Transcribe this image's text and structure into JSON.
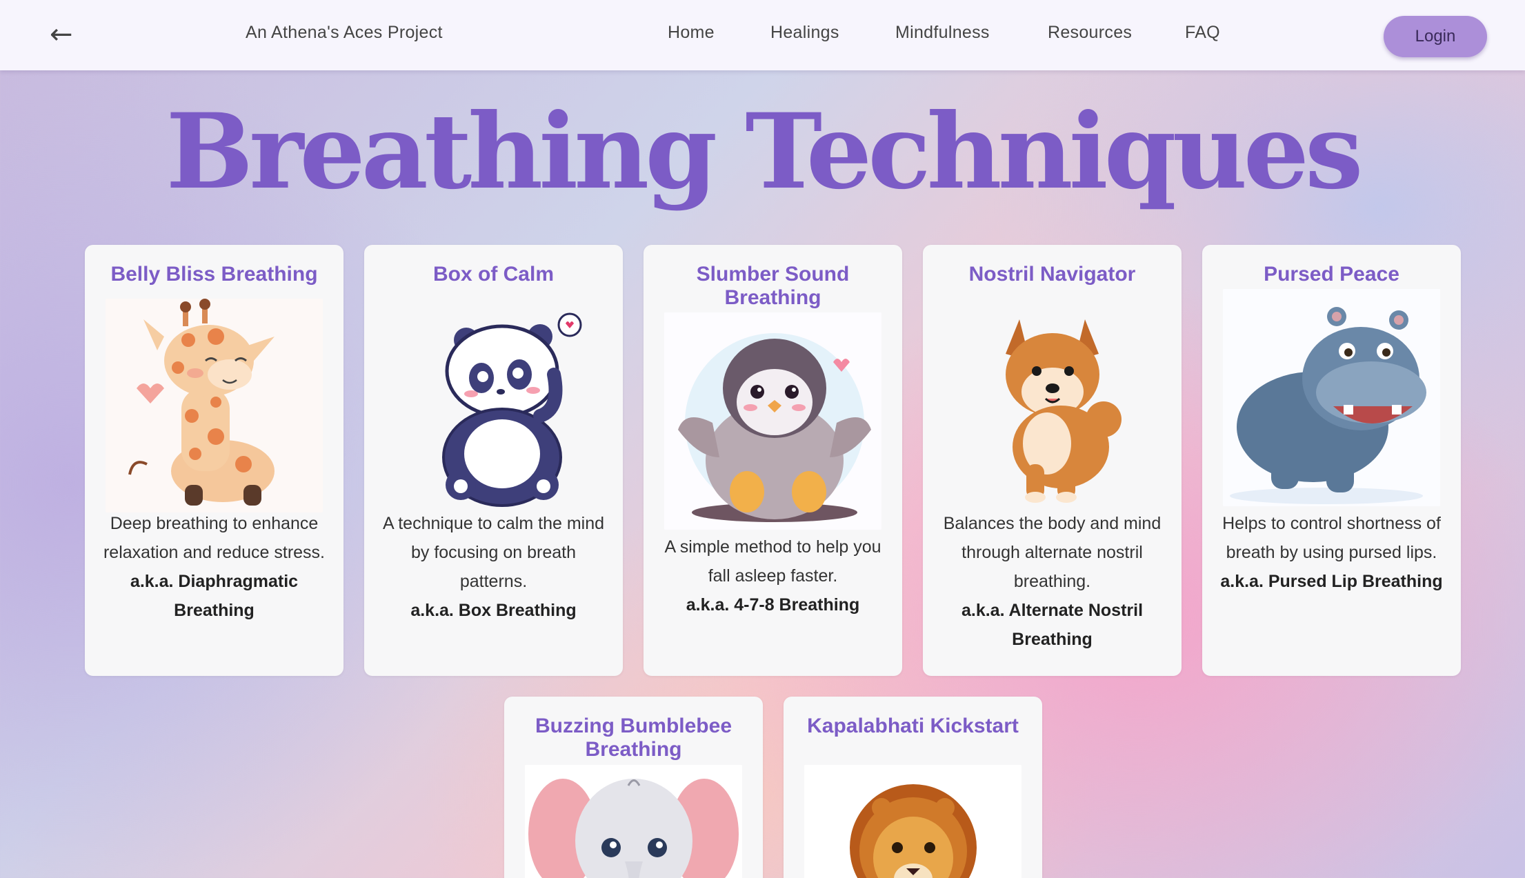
{
  "header": {
    "back_icon": "←",
    "brand": "An Athena's Aces Project",
    "nav": [
      "Home",
      "Healings",
      "Mindfulness",
      "Resources",
      "FAQ"
    ],
    "login_label": "Login"
  },
  "page": {
    "title": "Breathing Techniques"
  },
  "techniques": [
    {
      "title": "Belly Bliss Breathing",
      "description": "Deep breathing to enhance relaxation and reduce stress.",
      "aka": "a.k.a. Diaphragmatic Breathing",
      "image": "giraffe-illustration"
    },
    {
      "title": "Box of Calm",
      "description": "A technique to calm the mind by focusing on breath patterns.",
      "aka": "a.k.a. Box Breathing",
      "image": "panda-illustration"
    },
    {
      "title": "Slumber Sound Breathing",
      "description": "A simple method to help you fall asleep faster.",
      "aka": "a.k.a. 4-7-8 Breathing",
      "image": "penguin-illustration"
    },
    {
      "title": "Nostril Navigator",
      "description": "Balances the body and mind through alternate nostril breathing.",
      "aka": "a.k.a. Alternate Nostril Breathing",
      "image": "shiba-dog-illustration"
    },
    {
      "title": "Pursed Peace",
      "description": "Helps to control shortness of breath by using pursed lips.",
      "aka": "a.k.a. Pursed Lip Breathing",
      "image": "hippo-illustration"
    },
    {
      "title": "Buzzing Bumblebee Breathing",
      "description": "",
      "aka": "",
      "image": "elephant-illustration"
    },
    {
      "title": "Kapalabhati Kickstart",
      "description": "",
      "aka": "",
      "image": "lion-illustration"
    }
  ],
  "colors": {
    "accent": "#7c5cc6",
    "login_button": "#ac8fd9",
    "navbar": "#f7f5fd",
    "card": "#f7f7f8"
  }
}
